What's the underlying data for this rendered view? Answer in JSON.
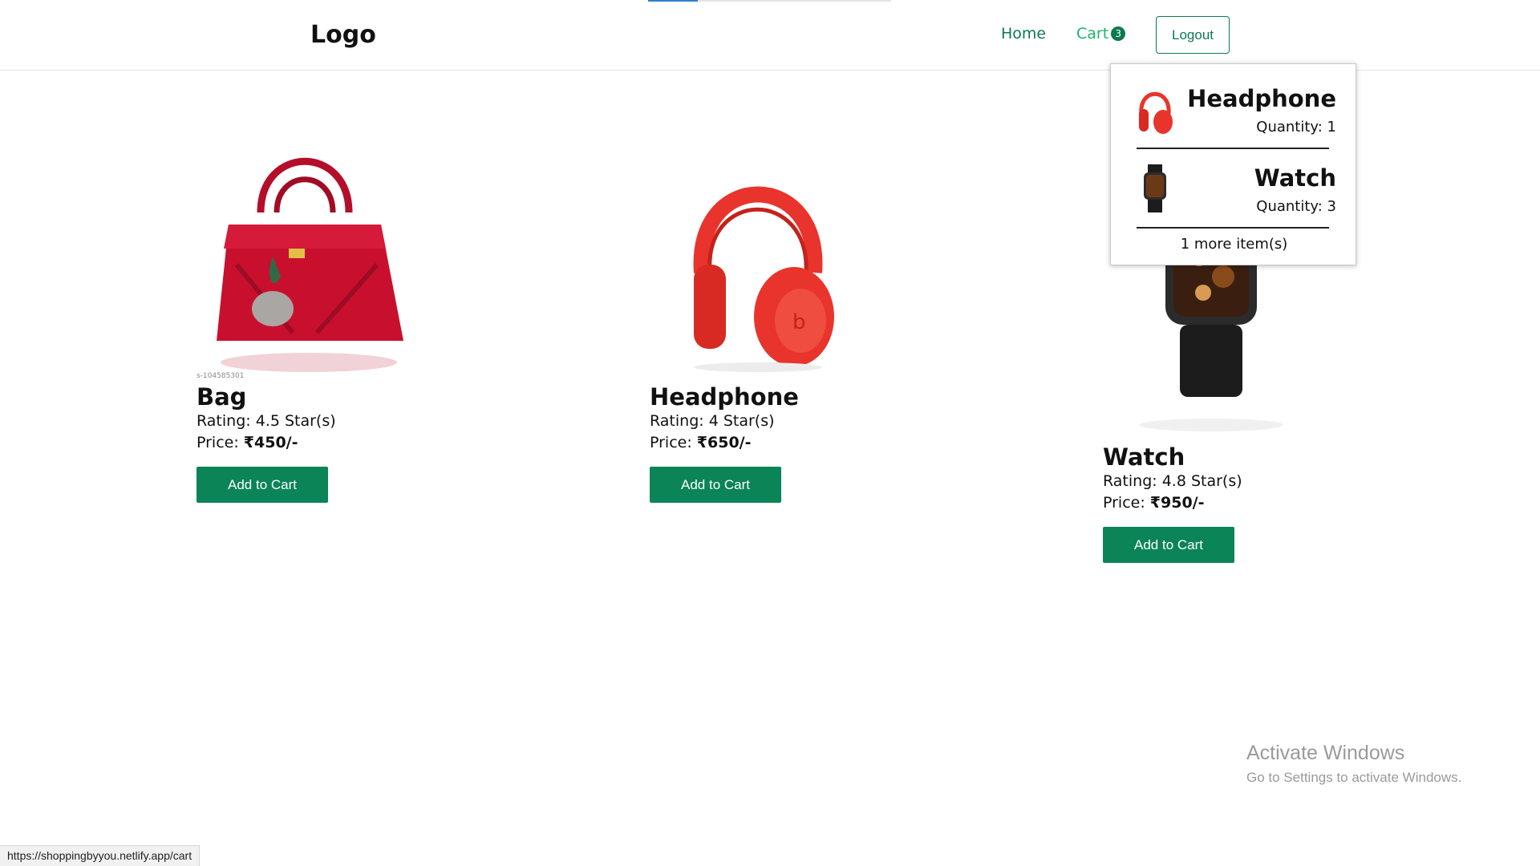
{
  "header": {
    "logo": "Logo",
    "nav": {
      "home": "Home",
      "cart": "Cart",
      "cart_count": "3"
    },
    "logout": "Logout"
  },
  "products": [
    {
      "name": "Bag",
      "rating": "Rating: 4.5 Star(s)",
      "price_label": "Price: ",
      "price": "₹450/-",
      "button": "Add to Cart",
      "image_caption": "s-104585301"
    },
    {
      "name": "Headphone",
      "rating": "Rating: 4 Star(s)",
      "price_label": "Price: ",
      "price": "₹650/-",
      "button": "Add to Cart"
    },
    {
      "name": "Watch",
      "rating": "Rating: 4.8 Star(s)",
      "price_label": "Price: ",
      "price": "₹950/-",
      "button": "Add to Cart"
    }
  ],
  "cart_dropdown": {
    "items": [
      {
        "name": "Headphone",
        "quantity": "Quantity: 1"
      },
      {
        "name": "Watch",
        "quantity": "Quantity: 3"
      }
    ],
    "more": "1 more item(s)"
  },
  "watermark": {
    "title": "Activate Windows",
    "subtitle": "Go to Settings to activate Windows."
  },
  "status_bar": {
    "url": "https://shoppingbyyou.netlify.app/cart"
  },
  "colors": {
    "primary": "#0b8457",
    "cart_link": "#1fb46a",
    "nav_link": "#0d7a4c",
    "bag": "#c8102e",
    "headphone": "#e8342c",
    "watch": "#1c1c1c"
  }
}
